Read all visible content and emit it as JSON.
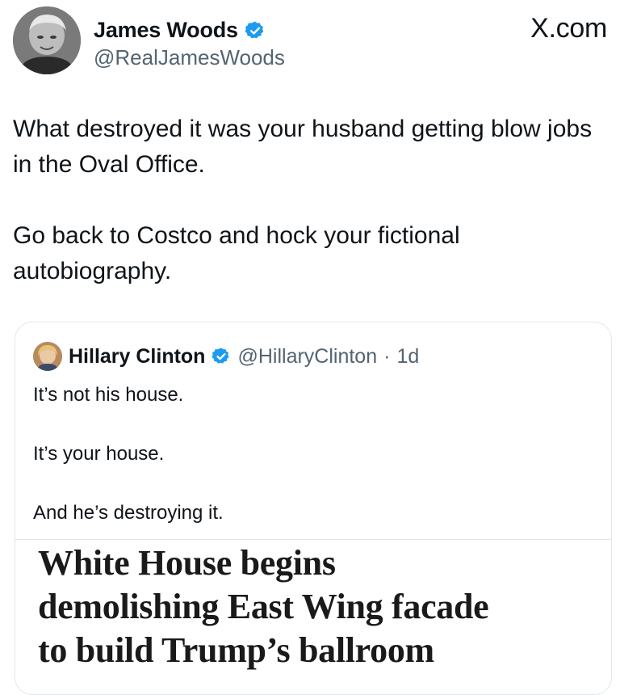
{
  "watermark": {
    "site": "X.com"
  },
  "author": {
    "display_name": "James Woods",
    "handle": "@RealJamesWoods",
    "verified": true,
    "verified_icon": "verified-badge-icon",
    "verified_color": "#1d9bf0"
  },
  "tweet": {
    "paragraphs": [
      "What destroyed it was your husband getting blow jobs in the Oval Office.",
      "Go back to Costco and hock your fictional autobiography."
    ]
  },
  "quoted_tweet": {
    "display_name": "Hillary Clinton",
    "handle": "@HillaryClinton",
    "separator": "·",
    "time": "1d",
    "verified": true,
    "lines": [
      "It’s not his house.",
      "It’s your house.",
      "And he’s destroying it."
    ],
    "headline_lines": [
      "White House begins",
      "demolishing East Wing facade",
      "to build Trump’s ballroom"
    ]
  }
}
